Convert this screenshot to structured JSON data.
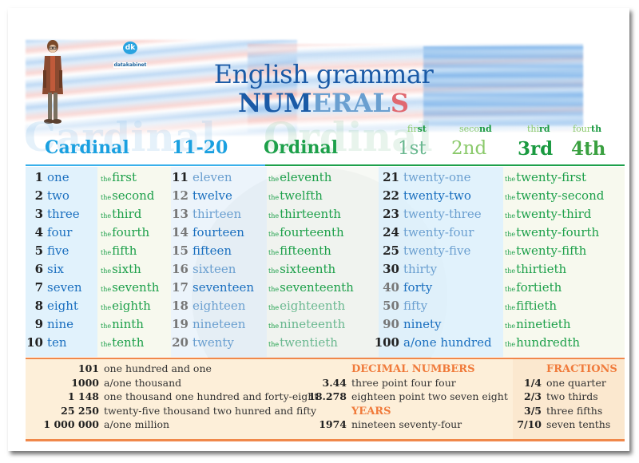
{
  "brand": {
    "logo_badge": "dk",
    "logo_text": "datakabinet"
  },
  "title": {
    "line1": "English grammar",
    "line2_a": "NUM",
    "line2_b": "ERAL",
    "line2_c": "S"
  },
  "headers": {
    "cardinal": "Cardinal",
    "range": "11-20",
    "ordinal": "Ordinal",
    "ghost_cardinal": "Cardinal",
    "ghost_ordinal": "Ordinal",
    "suffixes": [
      {
        "word_a": "fir",
        "word_b": "st",
        "big": "1st",
        "color": "#6ab890"
      },
      {
        "word_a": "seco",
        "word_b": "nd",
        "big": "2nd",
        "color": "#8ac96a"
      },
      {
        "word_a": "thi",
        "word_b": "rd",
        "big": "3rd",
        "color": "#1a9a40"
      },
      {
        "word_a": "four",
        "word_b": "th",
        "big": "4th",
        "color": "#1a9a40"
      }
    ]
  },
  "article": "the",
  "columns": {
    "c1": [
      {
        "num": "1",
        "word": "one",
        "ord": "first"
      },
      {
        "num": "2",
        "word": "two",
        "ord": "second"
      },
      {
        "num": "3",
        "word": "three",
        "ord": "third"
      },
      {
        "num": "4",
        "word": "four",
        "ord": "fourth"
      },
      {
        "num": "5",
        "word": "five",
        "ord": "fifth"
      },
      {
        "num": "6",
        "word": "six",
        "ord": "sixth"
      },
      {
        "num": "7",
        "word": "seven",
        "ord": "seventh"
      },
      {
        "num": "8",
        "word": "eight",
        "ord": "eighth"
      },
      {
        "num": "9",
        "word": "nine",
        "ord": "ninth"
      },
      {
        "num": "10",
        "word": "ten",
        "ord": "tenth"
      }
    ],
    "c2": [
      {
        "num": "11",
        "word": "eleven",
        "ord": "eleventh"
      },
      {
        "num": "12",
        "word": "twelve",
        "ord": "twelfth"
      },
      {
        "num": "13",
        "word": "thirteen",
        "ord": "thirteenth"
      },
      {
        "num": "14",
        "word": "fourteen",
        "ord": "fourteenth"
      },
      {
        "num": "15",
        "word": "fifteen",
        "ord": "fifteenth"
      },
      {
        "num": "16",
        "word": "sixteen",
        "ord": "sixteenth"
      },
      {
        "num": "17",
        "word": "seventeen",
        "ord": "seventeenth"
      },
      {
        "num": "18",
        "word": "eighteen",
        "ord": "eighteenth"
      },
      {
        "num": "19",
        "word": "nineteen",
        "ord": "nineteenth"
      },
      {
        "num": "20",
        "word": "twenty",
        "ord": "twentieth"
      }
    ],
    "c3": [
      {
        "num": "21",
        "word": "twenty-one",
        "ord": "twenty-first"
      },
      {
        "num": "22",
        "word": "twenty-two",
        "ord": "twenty-second"
      },
      {
        "num": "23",
        "word": "twenty-three",
        "ord": "twenty-third"
      },
      {
        "num": "24",
        "word": "twenty-four",
        "ord": "twenty-fourth"
      },
      {
        "num": "25",
        "word": "twenty-five",
        "ord": "twenty-fifth"
      },
      {
        "num": "30",
        "word": "thirty",
        "ord": "thirtieth"
      },
      {
        "num": "40",
        "word": "forty",
        "ord": "fortieth"
      },
      {
        "num": "50",
        "word": "fifty",
        "ord": "fiftieth"
      },
      {
        "num": "90",
        "word": "ninety",
        "ord": "ninetieth"
      },
      {
        "num": "100",
        "word": "a/one hundred",
        "ord": "hundredth"
      }
    ]
  },
  "bottom": {
    "large_numbers": [
      {
        "num": "101",
        "text": "one hundred and one"
      },
      {
        "num": "1000",
        "text": "a/one thousand"
      },
      {
        "num": "1 148",
        "text": "one thousand one hundred and forty-eight"
      },
      {
        "num": "25 250",
        "text": "twenty-five thousand two hunred and fifty"
      },
      {
        "num": "1 000 000",
        "text": "a/one million"
      }
    ],
    "decimal_heading": "DECIMAL NUMBERS",
    "decimals": [
      {
        "num": "3.44",
        "text": "three point four four"
      },
      {
        "num": "18.278",
        "text": "eighteen point two seven eight"
      }
    ],
    "years_heading": "YEARS",
    "years": [
      {
        "num": "1974",
        "text": "nineteen seventy-four"
      }
    ],
    "fractions_heading": "FRACTIONS",
    "fractions": [
      {
        "num": "1/4",
        "text": "one quarter"
      },
      {
        "num": "2/3",
        "text": "two thirds"
      },
      {
        "num": "3/5",
        "text": "three fifths"
      },
      {
        "num": "7/10",
        "text": "seven tenths"
      }
    ]
  },
  "colors": {
    "cardinal_blue": "#1aa0e0",
    "ordinal_green": "#1da04a",
    "title_blue": "#1a5aa6",
    "accent_orange": "#f0884a",
    "title_red": "#e06870"
  }
}
